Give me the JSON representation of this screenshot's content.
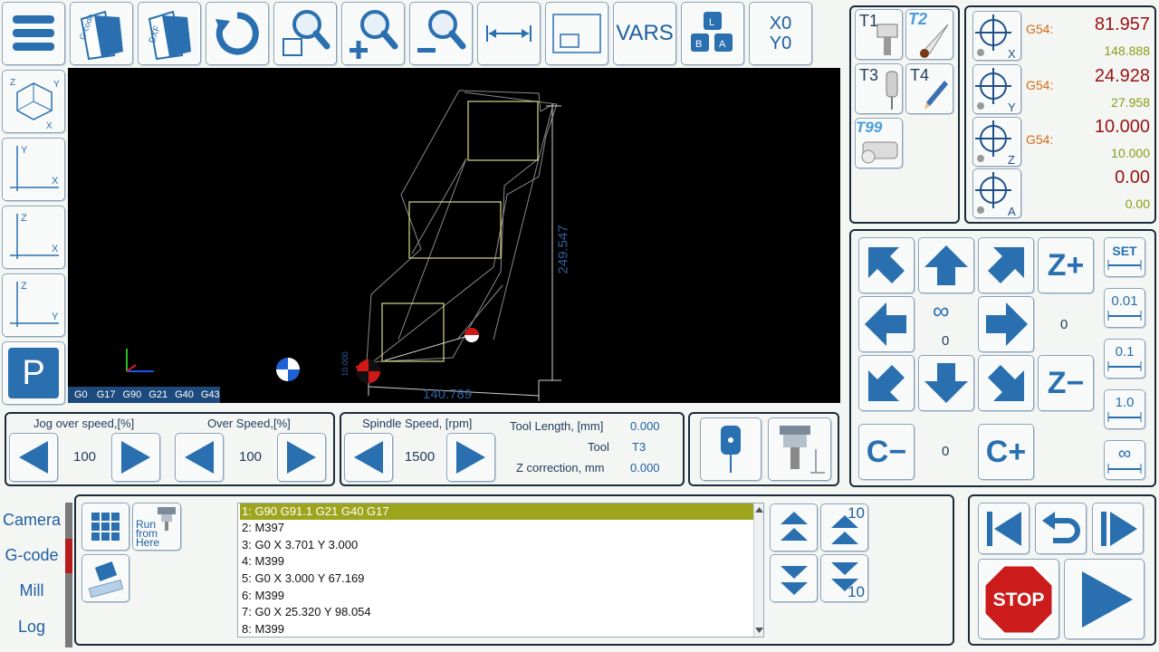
{
  "toolbar": {
    "gcode_icon_text": "G-code",
    "dxf_icon_text": "DXF",
    "vars_label": "VARS",
    "x0y0_line1": "X0",
    "x0y0_line2": "Y0"
  },
  "views": {
    "iso_axes": [
      "Z",
      "Y",
      "X"
    ],
    "xy_axes": [
      "Y",
      "X"
    ],
    "zx_axes": [
      "Z",
      "X"
    ],
    "zy_axes": [
      "Z",
      "Y"
    ],
    "park_label": "P"
  },
  "viewport": {
    "status_codes": [
      "G0",
      "G17",
      "G90",
      "G21",
      "G40",
      "G43"
    ],
    "dim_height": "249.547",
    "dim_width": "140.789",
    "dim_small": "10.000"
  },
  "tools": {
    "t1": "T1",
    "t2": "T2",
    "t3": "T3",
    "t4": "T4",
    "t99": "T99"
  },
  "dro": {
    "axes": [
      {
        "axis": "X",
        "wcs": "G54:",
        "work": "81.957",
        "machine": "148.888"
      },
      {
        "axis": "Y",
        "wcs": "G54:",
        "work": "24.928",
        "machine": "27.958"
      },
      {
        "axis": "Z",
        "wcs": "G54:",
        "work": "10.000",
        "machine": "10.000"
      },
      {
        "axis": "A",
        "wcs": "",
        "work": "0.00",
        "machine": "0.00"
      }
    ]
  },
  "jog": {
    "zplus": "Z+",
    "zminus": "Z−",
    "cminus": "C−",
    "cplus": "C+",
    "infinity": "∞",
    "center_value": "0",
    "z_value": "0",
    "c_value": "0",
    "steps": [
      "SET",
      "0.01",
      "0.1",
      "1.0",
      "∞"
    ]
  },
  "speeds": {
    "jog_label": "Jog over speed,[%]",
    "jog_value": "100",
    "over_label": "Over Speed,[%]",
    "over_value": "100",
    "spindle_label": "Spindle Speed, [rpm]",
    "spindle_value": "1500",
    "tool_length_label": "Tool Length, [mm]",
    "tool_length_value": "0.000",
    "tool_label": "Tool",
    "tool_value": "T3",
    "zcorr_label": "Z correction, mm",
    "zcorr_value": "0.000"
  },
  "tabs": [
    "Camera",
    "G-code",
    "Mill",
    "Log"
  ],
  "gcode": {
    "run_from_here": [
      "Run",
      "from",
      "Here"
    ],
    "lines": [
      "1: G90 G91.1 G21 G40 G17",
      "2: M397",
      "3: G0 X 3.701 Y 3.000",
      "4: M399",
      "5: G0 X 3.000 Y 67.169",
      "6: M399",
      "7: G0 X 25.320 Y 98.054",
      "8: M399"
    ],
    "scroll_step": "10"
  },
  "run": {
    "stop_label": "STOP"
  },
  "colors": {
    "icon_blue": "#2a6fb0",
    "dro_red": "#9b1212",
    "dro_green": "#8c9b14",
    "wcs_orange": "#d66a14",
    "highlight": "#9da51d",
    "viewport_bg": "#000000"
  }
}
